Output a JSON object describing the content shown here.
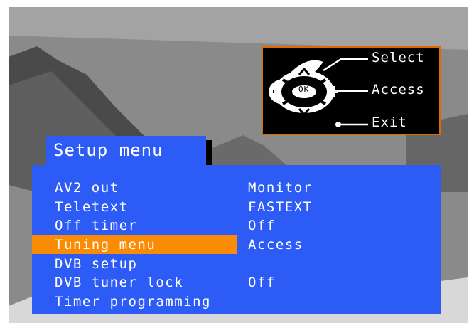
{
  "help": {
    "select_label": "Select",
    "access_label": "Access",
    "exit_label": "Exit",
    "ok_label": "OK"
  },
  "menu": {
    "title": "Setup menu",
    "items": [
      {
        "label": "AV2 out",
        "value": "Monitor",
        "selected": false
      },
      {
        "label": "Teletext",
        "value": "FASTEXT",
        "selected": false
      },
      {
        "label": "Off timer",
        "value": "Off",
        "selected": false
      },
      {
        "label": "Tuning menu",
        "value": "Access",
        "selected": true
      },
      {
        "label": "DVB setup",
        "value": "",
        "selected": false
      },
      {
        "label": "DVB tuner lock",
        "value": "Off",
        "selected": false
      },
      {
        "label": "Timer programming",
        "value": "",
        "selected": false
      }
    ]
  },
  "colors": {
    "menu_blue": "#2c5cf5",
    "highlight_orange": "#f98b05",
    "panel_border": "#e06a00"
  },
  "icons": [
    "up-arrow-icon",
    "down-arrow-icon",
    "left-minus-icon",
    "right-plus-icon",
    "ok-button-icon",
    "exit-dot-icon"
  ]
}
